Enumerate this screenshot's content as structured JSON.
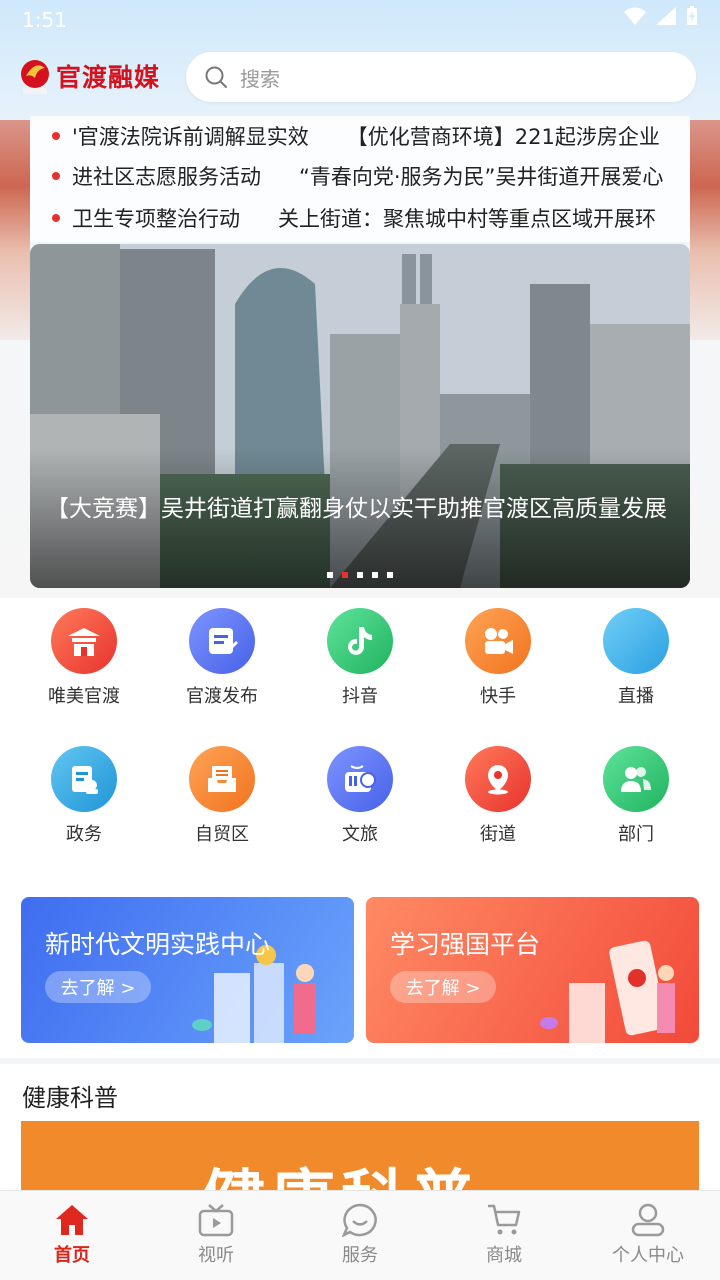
{
  "status": {
    "time": "1:51"
  },
  "header": {
    "logo_text": "官渡融媒",
    "search_placeholder": "搜索"
  },
  "ticker": [
    {
      "a": "'官渡法院诉前调解显实效",
      "b": "【优化营商环境】221起涉房企业"
    },
    {
      "a": "进社区志愿服务活动",
      "b": "“青春向党·服务为民”吴井街道开展爱心"
    },
    {
      "a": "卫生专项整治行动",
      "b": "关上街道：聚焦城中村等重点区域开展环"
    }
  ],
  "banner": {
    "caption": "【大竞赛】吴井街道打赢翻身仗以实干助推官渡区高质量发展",
    "active_dot": 2,
    "dot_count": 5
  },
  "grid": [
    {
      "label": "唯美官渡",
      "icon": "pavilion-icon",
      "color": "#f0473e"
    },
    {
      "label": "官渡发布",
      "icon": "document-edit-icon",
      "color": "#4f6ff0"
    },
    {
      "label": "抖音",
      "icon": "tiktok-icon",
      "color": "#26c46e"
    },
    {
      "label": "快手",
      "icon": "kuaishou-icon",
      "color": "#f58a2d"
    },
    {
      "label": "直播",
      "icon": "live-icon",
      "color": "#3eb4ee"
    },
    {
      "label": "政务",
      "icon": "gov-doc-icon",
      "color": "#2fa9e3"
    },
    {
      "label": "自贸区",
      "icon": "inbox-icon",
      "color": "#f58a2d"
    },
    {
      "label": "文旅",
      "icon": "radio-icon",
      "color": "#4f6ff0"
    },
    {
      "label": "街道",
      "icon": "location-icon",
      "color": "#f0473e"
    },
    {
      "label": "部门",
      "icon": "people-icon",
      "color": "#26c46e"
    }
  ],
  "promos": [
    {
      "title": "新时代文明实践中心",
      "button": "去了解 >",
      "color": "#4a7af2"
    },
    {
      "title": "学习强国平台",
      "button": "去了解 >",
      "color": "#f2594b"
    }
  ],
  "health": {
    "title": "健康科普",
    "banner_text": "健康科普"
  },
  "tabs": [
    {
      "label": "首页",
      "icon": "home-icon",
      "active": true
    },
    {
      "label": "视听",
      "icon": "tv-icon",
      "active": false
    },
    {
      "label": "服务",
      "icon": "chat-smile-icon",
      "active": false
    },
    {
      "label": "商城",
      "icon": "cart-icon",
      "active": false
    },
    {
      "label": "个人中心",
      "icon": "user-icon",
      "active": false
    }
  ]
}
